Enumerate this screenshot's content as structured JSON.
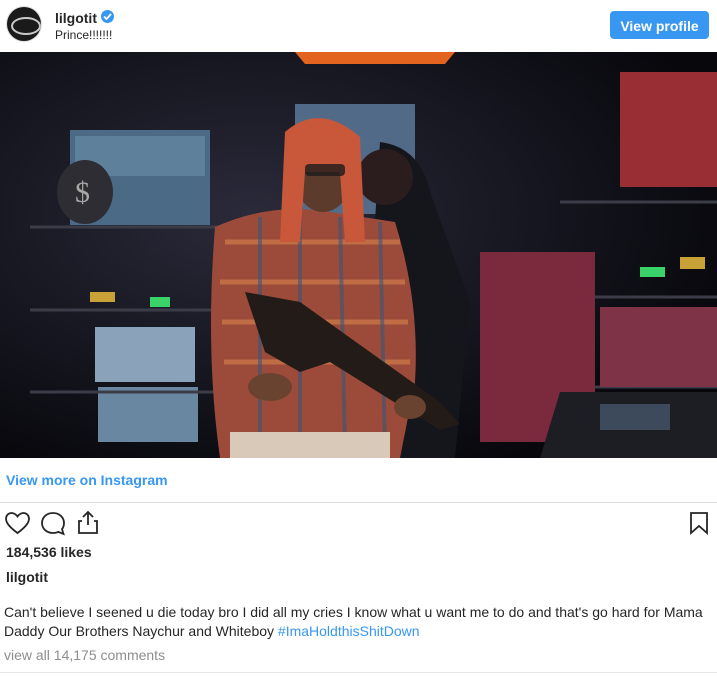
{
  "header": {
    "username": "lilgotit",
    "location": "Prince!!!!!!!",
    "view_profile_label": "View profile"
  },
  "post": {
    "view_more_label": "View more on Instagram",
    "likes": "184,536 likes",
    "owner": "lilgotit",
    "caption_text": "Can't believe I seened u die today bro I did all my cries I know what u want me to do and that's go hard for Mama Daddy Our Brothers Naychur and Whiteboy ",
    "caption_hashtag": "#ImaHoldthisShitDown",
    "comments_label": "view all 14,175 comments"
  },
  "icons": {
    "verified": "verified-badge-icon",
    "like": "heart-icon",
    "comment": "comment-bubble-icon",
    "share": "share-upload-icon",
    "save": "bookmark-icon"
  },
  "colors": {
    "accent": "#3897f0",
    "text": "#262626",
    "muted": "#8e8e8e",
    "divider": "#dbdbdb"
  }
}
